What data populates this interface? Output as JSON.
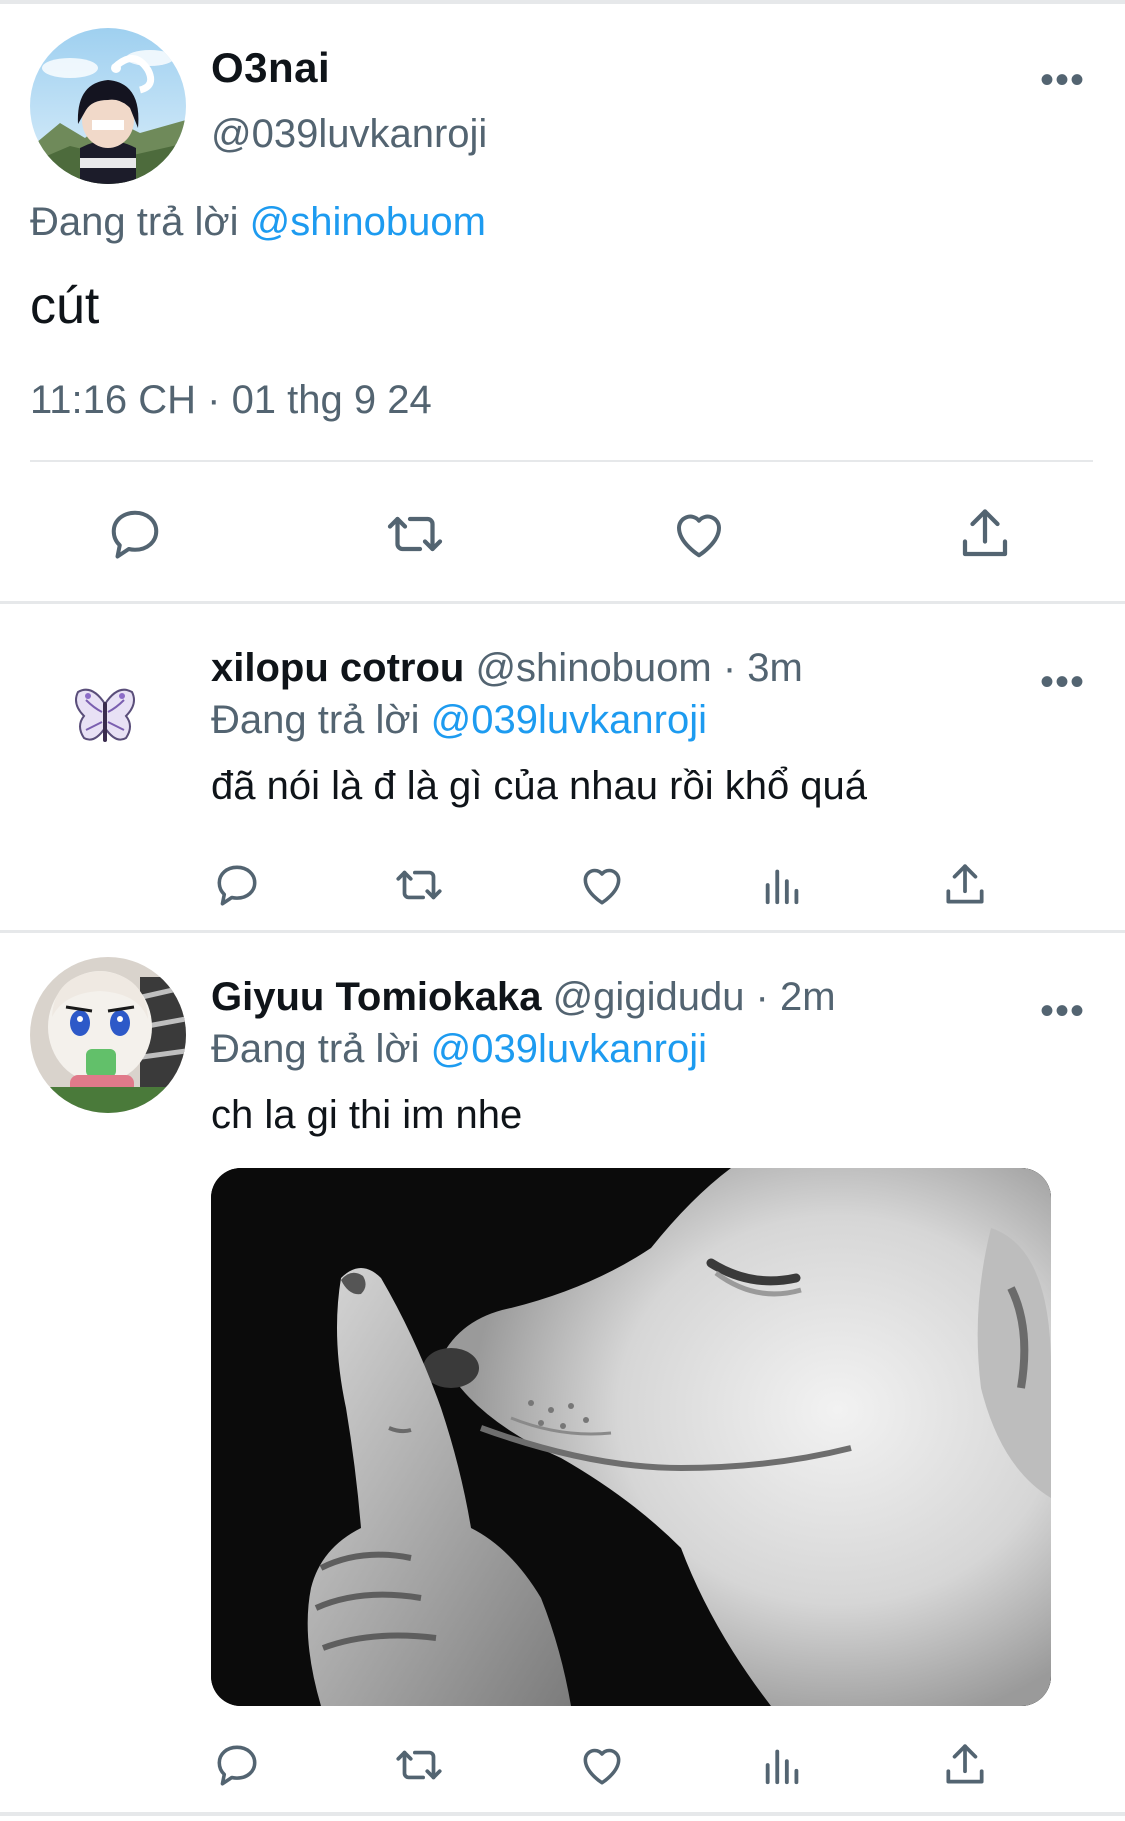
{
  "main_tweet": {
    "display_name": "O3nai",
    "handle": "@039luvkanroji",
    "replying_prefix": "Đang trả lời",
    "replying_to": "@shinobuom",
    "text": "cút",
    "timestamp": "11:16 CH · 01 thg 9 24",
    "more_label": "•••",
    "actions": [
      "reply-icon",
      "retweet-icon",
      "like-icon",
      "share-icon"
    ]
  },
  "replies": [
    {
      "display_name": "xilopu cotrou",
      "handle": "@shinobuom · 3m",
      "replying_prefix": "Đang trả lời",
      "replying_to": "@039luvkanroji",
      "text": "đã nói là đ là gì của nhau rồi khổ quá",
      "more_label": "•••",
      "actions": [
        "reply-icon",
        "retweet-icon",
        "like-icon",
        "views-icon",
        "share-icon"
      ]
    },
    {
      "display_name": "Giyuu Tomiokaka",
      "handle": "@gigidudu · 2m",
      "replying_prefix": "Đang trả lời",
      "replying_to": "@039luvkanroji",
      "text": "ch la gi thi im nhe",
      "more_label": "•••",
      "media": "shh-dog-meme-image",
      "actions": [
        "reply-icon",
        "retweet-icon",
        "like-icon",
        "views-icon",
        "share-icon"
      ]
    }
  ],
  "colors": {
    "text": "#0f1419",
    "secondary": "#536471",
    "link": "#1d9bf0",
    "divider": "#e6e8ea"
  }
}
